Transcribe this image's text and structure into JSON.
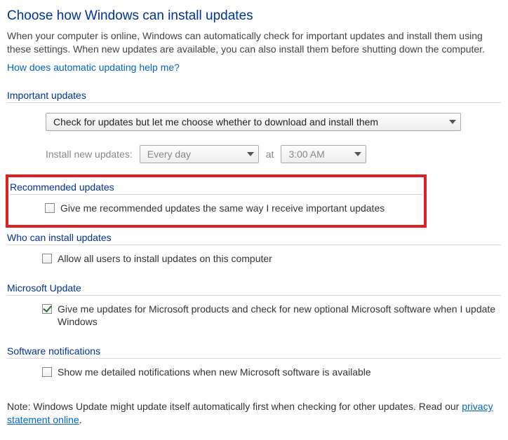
{
  "title": "Choose how Windows can install updates",
  "intro": "When your computer is online, Windows can automatically check for important updates and install them using these settings. When new updates are available, you can also install them before shutting down the computer.",
  "help_link": "How does automatic updating help me?",
  "important_updates": {
    "heading": "Important updates",
    "mode_selected": "Check for updates but let me choose whether to download and install them",
    "schedule_label": "Install new updates:",
    "day_selected": "Every day",
    "at_label": "at",
    "time_selected": "3:00 AM"
  },
  "recommended_updates": {
    "heading": "Recommended updates",
    "checkbox_label": "Give me recommended updates the same way I receive important updates",
    "checked": false
  },
  "who_can_install": {
    "heading": "Who can install updates",
    "checkbox_label": "Allow all users to install updates on this computer",
    "checked": false
  },
  "microsoft_update": {
    "heading": "Microsoft Update",
    "checkbox_label": "Give me updates for Microsoft products and check for new optional Microsoft software when I update Windows",
    "checked": true
  },
  "software_notifications": {
    "heading": "Software notifications",
    "checkbox_label": "Show me detailed notifications when new Microsoft software is available",
    "checked": false
  },
  "note_prefix": "Note: Windows Update might update itself automatically first when checking for other updates.  Read our ",
  "note_link": "privacy statement online",
  "note_suffix": "."
}
